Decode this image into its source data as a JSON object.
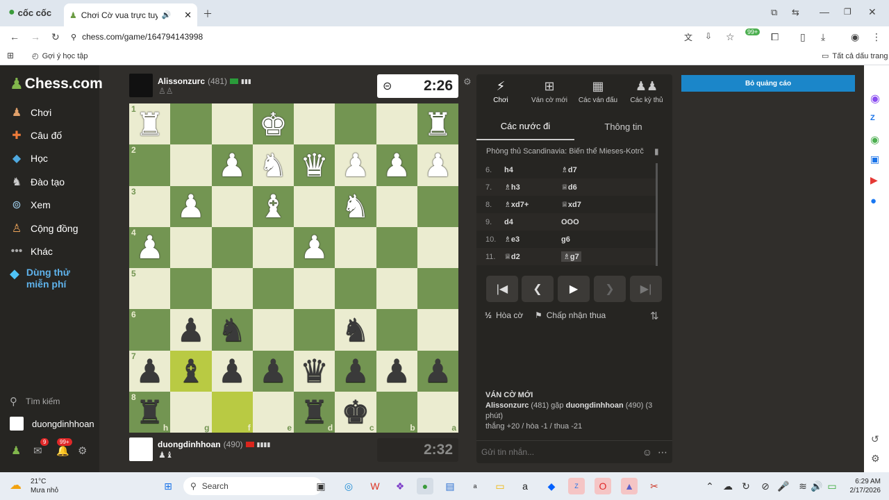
{
  "browser": {
    "brand": "cốc cốc",
    "tab_title": "Chơi Cờ vua trực tuyến",
    "url": "chess.com/game/164794143998",
    "bookmark": "Gợi ý học tập",
    "all_bookmarks": "Tất cả dấu trang",
    "badge": "99+"
  },
  "sidebar": {
    "logo": "Chess.com",
    "items": [
      {
        "label": "Chơi",
        "icon": "pawn-icon"
      },
      {
        "label": "Câu đố",
        "icon": "puzzle-icon"
      },
      {
        "label": "Học",
        "icon": "graduation-cap-icon"
      },
      {
        "label": "Đào tạo",
        "icon": "training-icon"
      },
      {
        "label": "Xem",
        "icon": "binoculars-icon"
      },
      {
        "label": "Cộng đồng",
        "icon": "community-icon"
      },
      {
        "label": "Khác",
        "icon": "more-icon"
      }
    ],
    "trial_line1": "Dùng thử",
    "trial_line2": "miễn phí",
    "search": "Tìm kiếm",
    "user": "duongdinhhoan",
    "mail_badge": "9",
    "notif_badge": "99+"
  },
  "top_player": {
    "name": "Alissonzurc",
    "rating": "(481)",
    "clock": "2:26"
  },
  "bottom_player": {
    "name": "duongdinhhoan",
    "rating": "(490)",
    "clock": "2:32"
  },
  "panel": {
    "tabs": [
      "Chơi",
      "Ván cờ mới",
      "Các ván đấu",
      "Các kỳ thủ"
    ],
    "subtabs": [
      "Các nước đi",
      "Thông tin"
    ],
    "opening": "Phòng thủ Scandinavia: Biến thể Mieses-Kotrč",
    "moves": [
      {
        "n": "6.",
        "w": "h4",
        "b": "♗d7"
      },
      {
        "n": "7.",
        "w": "♗h3",
        "b": "♕d6"
      },
      {
        "n": "8.",
        "w": "♗xd7+",
        "b": "♕xd7"
      },
      {
        "n": "9.",
        "w": "d4",
        "b": "OOO"
      },
      {
        "n": "10.",
        "w": "♗e3",
        "b": "g6"
      },
      {
        "n": "11.",
        "w": "♕d2",
        "b": "♗g7"
      }
    ],
    "draw": "Hòa cờ",
    "resign": "Chấp nhận thua",
    "new_game_title": "VÁN CỜ MỚI",
    "new_game_p1": "Alissonzurc",
    "new_game_r1": "(481)",
    "new_game_vs": "gặp",
    "new_game_p2": "duongdinhhoan",
    "new_game_r2": "(490) (3 phút)",
    "new_game_result": "thắng +20 / hòa -1 / thua -21",
    "chat_placeholder": "Gửi tin nhắn..."
  },
  "ad": {
    "label": "Bỏ quảng cáo"
  },
  "taskbar": {
    "temp": "21°C",
    "weather": "Mưa nhỏ",
    "search": "Search",
    "time": "6:29 AM",
    "date": "2/17/2026"
  },
  "board": {
    "ranks": [
      "1",
      "2",
      "3",
      "4",
      "5",
      "6",
      "7",
      "8"
    ],
    "files": [
      "h",
      "g",
      "f",
      "e",
      "d",
      "c",
      "b",
      "a"
    ],
    "rows": [
      [
        "wR",
        "",
        "",
        "wK",
        "",
        "",
        "",
        "wR"
      ],
      [
        "",
        "",
        "wP",
        "wN",
        "wQ",
        "wP",
        "wP",
        "wP"
      ],
      [
        "",
        "wP",
        "",
        "wB",
        "",
        "wN",
        "",
        ""
      ],
      [
        "wP",
        "",
        "",
        "",
        "wP",
        "",
        "",
        ""
      ],
      [
        "",
        "",
        "",
        "",
        "",
        "",
        "",
        ""
      ],
      [
        "",
        "bP",
        "bN",
        "",
        "",
        "bN",
        "",
        ""
      ],
      [
        "bP",
        "bB",
        "bP",
        "bP",
        "bQ",
        "bP",
        "bP",
        "bP"
      ],
      [
        "bR",
        "",
        "",
        "",
        "bR",
        "bK",
        "",
        ""
      ]
    ],
    "highlight": [
      "7-1",
      "8-2"
    ]
  }
}
